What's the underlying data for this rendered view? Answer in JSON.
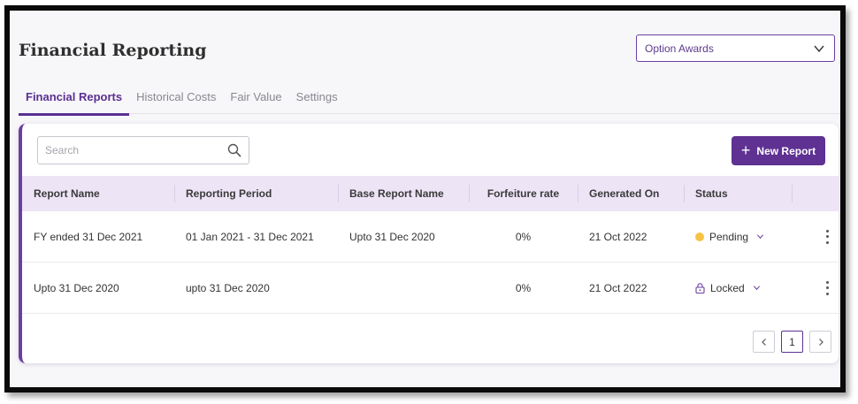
{
  "page": {
    "title": "Financial Reporting"
  },
  "selector": {
    "value": "Option Awards"
  },
  "tabs": [
    {
      "label": "Financial Reports",
      "active": true
    },
    {
      "label": "Historical Costs",
      "active": false
    },
    {
      "label": "Fair Value",
      "active": false
    },
    {
      "label": "Settings",
      "active": false
    }
  ],
  "search": {
    "placeholder": "Search",
    "icon": "search-icon"
  },
  "new_report": {
    "label": "New Report",
    "icon": "plus-icon"
  },
  "table": {
    "columns": [
      "Report Name",
      "Reporting Period",
      "Base Report Name",
      "Forfeiture rate",
      "Generated On",
      "Status"
    ],
    "rows": [
      {
        "report_name": "FY ended 31 Dec 2021",
        "reporting_period": "01 Jan 2021 - 31 Dec 2021",
        "base_report": "Upto 31 Dec 2020",
        "forfeiture_rate": "0%",
        "generated_on": "21 Oct 2022",
        "status": "Pending",
        "status_icon": "pending-dot-icon"
      },
      {
        "report_name": "Upto 31 Dec 2020",
        "reporting_period": "upto 31 Dec 2020",
        "base_report": "",
        "forfeiture_rate": "0%",
        "generated_on": "21 Oct 2022",
        "status": "Locked",
        "status_icon": "lock-icon"
      }
    ]
  },
  "pagination": {
    "current_page": "1"
  },
  "colors": {
    "accent": "#5e3192",
    "header_bg": "#ede4f6",
    "pending": "#f7c244"
  }
}
